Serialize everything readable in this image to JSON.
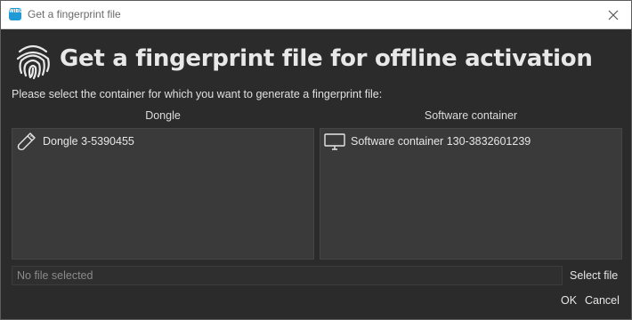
{
  "window": {
    "title": "Get a fingerprint file",
    "app_icon_text": "WIBU"
  },
  "heading": "Get a fingerprint file for offline activation",
  "instruction": "Please select the container for which you want to generate a fingerprint file:",
  "columns": {
    "dongle": {
      "header": "Dongle",
      "items": [
        {
          "label": "Dongle 3-5390455",
          "icon": "usb-dongle-icon"
        }
      ]
    },
    "software": {
      "header": "Software container",
      "items": [
        {
          "label": "Software container 130-3832601239",
          "icon": "monitor-icon"
        }
      ]
    }
  },
  "file": {
    "placeholder": "No file selected",
    "select_label": "Select file"
  },
  "buttons": {
    "ok": "OK",
    "cancel": "Cancel"
  },
  "colors": {
    "background": "#2b2b2b",
    "panel": "#3a3a3a",
    "titlebar": "#ffffff",
    "app_icon": "#1e9bd7"
  }
}
